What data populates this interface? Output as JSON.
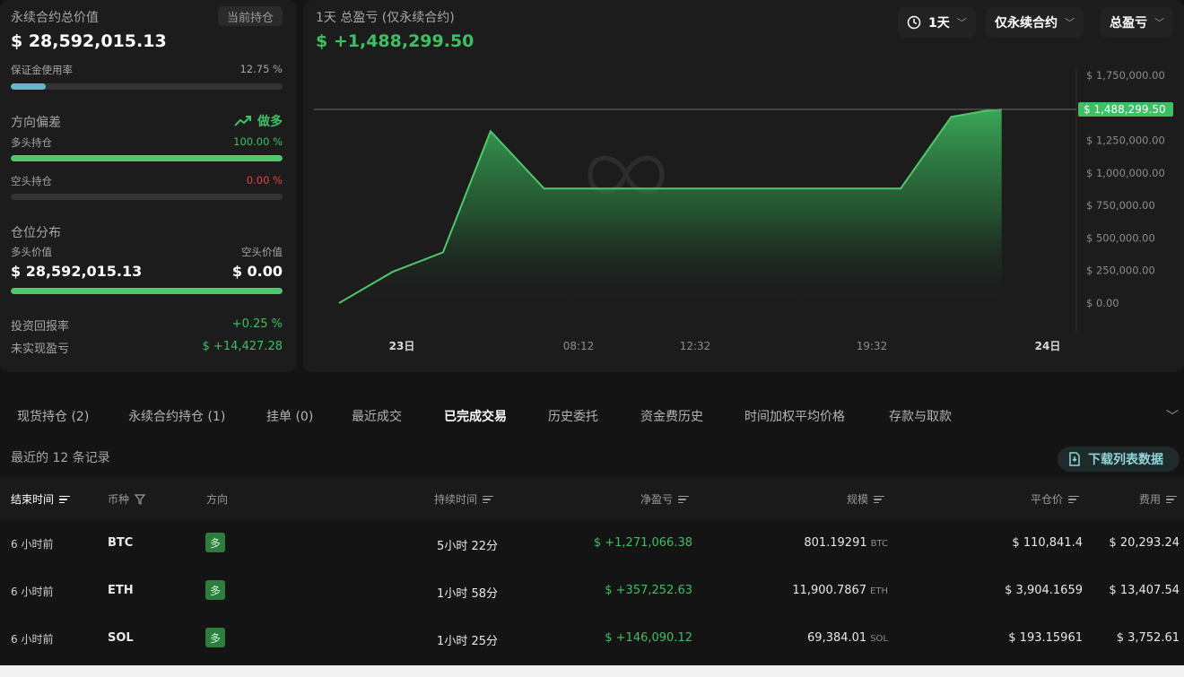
{
  "summary": {
    "title": "永续合约总价值",
    "toggle_label": "当前持仓",
    "total_value": "$ 28,592,015.13",
    "margin": {
      "label": "保证金使用率",
      "value": "12.75 %",
      "fraction": 0.1275
    },
    "bias": {
      "label": "方向偏差",
      "value": "做多"
    },
    "long": {
      "label": "多头持仓",
      "value": "100.00 %",
      "fraction": 1.0
    },
    "short": {
      "label": "空头持仓",
      "value": "0.00 %",
      "fraction": 0.0
    },
    "distribution": {
      "title": "仓位分布",
      "long_label": "多头价值",
      "short_label": "空头价值",
      "long_value": "$ 28,592,015.13",
      "short_value": "$ 0.00",
      "long_fraction": 1.0
    },
    "roi": {
      "label": "投资回报率",
      "value": "+0.25 %"
    },
    "unrealized": {
      "label": "未实现盈亏",
      "value": "$ +14,427.28"
    }
  },
  "pnl_chart": {
    "title": "1天 总盈亏 (仅永续合约)",
    "value": "$ +1,488,299.50",
    "controls": {
      "period": "1天",
      "scope": "仅永续合约",
      "metric": "总盈亏"
    },
    "current_label": "$ 1,488,299.50"
  },
  "chart_data": {
    "type": "area",
    "title": "1天 总盈亏 (仅永续合约)",
    "x_ticks": [
      "23日",
      "08:12",
      "12:32",
      "19:32",
      "24日"
    ],
    "y_ticks": [
      "$ 1,750,000.00",
      "$ 1,500,000.00",
      "$ 1,250,000.00",
      "$ 1,000,000.00",
      "$ 750,000.00",
      "$ 500,000.00",
      "$ 250,000.00",
      "$ 0.00"
    ],
    "ylim": [
      0,
      1750000
    ],
    "xlim": [
      0,
      24
    ],
    "series": [
      {
        "x": [
          0.0,
          1.8,
          3.5,
          5.1,
          6.9,
          7.9,
          10.0,
          14.0,
          17.0,
          18.9,
          20.6,
          21.7,
          22.3
        ],
        "y": [
          0,
          240000,
          390000,
          1320000,
          880000,
          880000,
          880000,
          880000,
          880000,
          880000,
          1430000,
          1475000,
          1488299.5
        ]
      }
    ],
    "current_value": 1488299.5,
    "color": "#3fbf63",
    "grid": false
  },
  "tabs": [
    {
      "label": "现货持仓 (2)"
    },
    {
      "label": "永续合约持仓 (1)"
    },
    {
      "label": "挂单 (0)"
    },
    {
      "label": "最近成交"
    },
    {
      "label": "已完成交易"
    },
    {
      "label": "历史委托"
    },
    {
      "label": "资金费历史"
    },
    {
      "label": "时间加权平均价格"
    },
    {
      "label": "存款与取款"
    }
  ],
  "active_tab": "已完成交易",
  "records_label": "最近的 12 条记录",
  "download_label": "下载列表数据",
  "table": {
    "headers": {
      "end_time": "结束时间",
      "coin": "币种",
      "direction": "方向",
      "duration": "持续时间",
      "pnl": "净盈亏",
      "size": "规模",
      "close_price": "平仓价",
      "fee": "费用"
    },
    "rows": [
      {
        "end_time": "6 小时前",
        "coin": "BTC",
        "direction": "多",
        "duration": "5小时 22分",
        "pnl": "$ +1,271,066.38",
        "size": "801.19291",
        "size_unit": "BTC",
        "close_price": "$ 110,841.4",
        "fee": "$ 20,293.24"
      },
      {
        "end_time": "6 小时前",
        "coin": "ETH",
        "direction": "多",
        "duration": "1小时 58分",
        "pnl": "$ +357,252.63",
        "size": "11,900.7867",
        "size_unit": "ETH",
        "close_price": "$ 3,904.1659",
        "fee": "$ 13,407.54"
      },
      {
        "end_time": "6 小时前",
        "coin": "SOL",
        "direction": "多",
        "duration": "1小时 25分",
        "pnl": "$ +146,090.12",
        "size": "69,384.01",
        "size_unit": "SOL",
        "close_price": "$ 193.15961",
        "fee": "$ 3,752.61"
      }
    ]
  }
}
